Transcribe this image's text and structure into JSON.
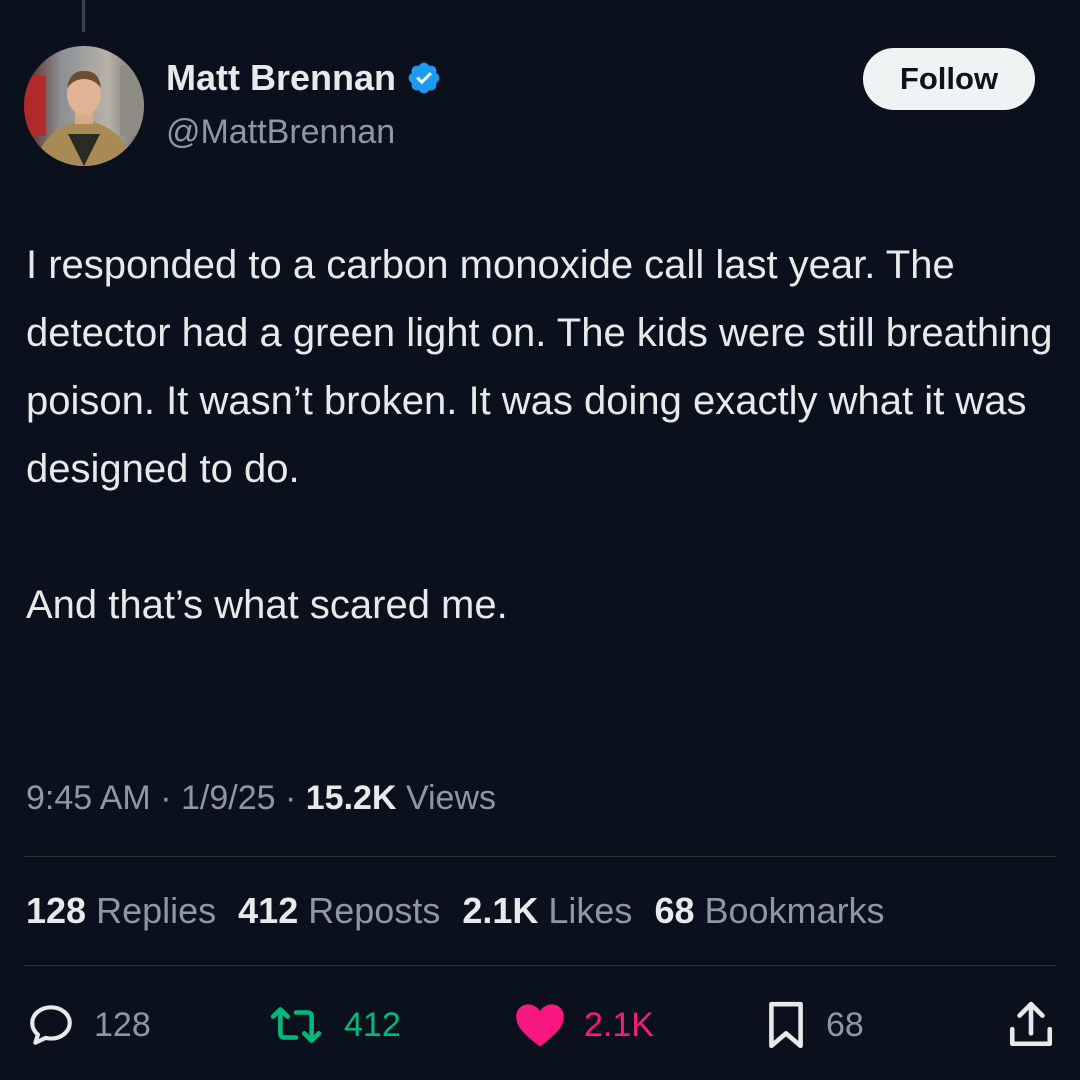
{
  "author": {
    "display_name": "Matt Brennan",
    "handle": "@MattBrennan",
    "verified": true,
    "verified_color": "#1d9bf0"
  },
  "follow_label": "Follow",
  "tweet": {
    "paragraphs": [
      "I responded to a carbon monoxide call last year. The detector had a green light on. The kids were still breathing poison. It wasn’t broken. It was doing exactly what it was designed to do.",
      "And that’s what scared me."
    ]
  },
  "meta": {
    "time": "9:45 AM",
    "separator": "·",
    "date": "1/9/25",
    "views_count": "15.2K",
    "views_label": "Views"
  },
  "stats": {
    "replies": {
      "num": "128",
      "label": "Replies"
    },
    "reposts": {
      "num": "412",
      "label": "Reposts"
    },
    "likes": {
      "num": "2.1K",
      "label": "Likes"
    },
    "bookmarks": {
      "num": "68",
      "label": "Bookmarks"
    }
  },
  "actions": {
    "reply": {
      "icon": "reply-icon",
      "count": "128",
      "color": "#8b98a5"
    },
    "repost": {
      "icon": "repost-icon",
      "count": "412",
      "color": "#00ba7c"
    },
    "like": {
      "icon": "heart-icon",
      "count": "2.1K",
      "color": "#f91880",
      "liked": true
    },
    "bookmark": {
      "icon": "bookmark-icon",
      "count": "68",
      "color": "#8b98a5"
    },
    "share": {
      "icon": "share-icon"
    }
  }
}
